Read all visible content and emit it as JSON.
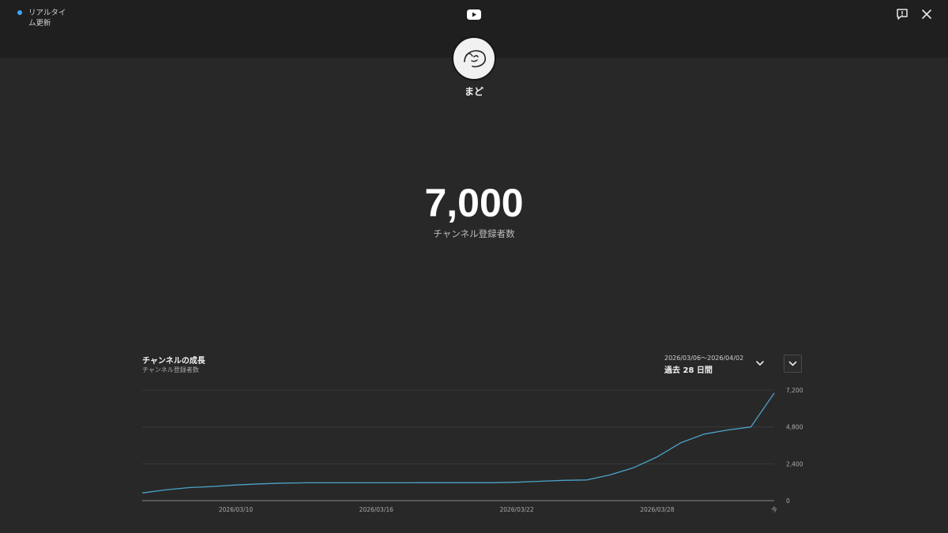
{
  "header": {
    "realtime_label": "リアルタイム更新",
    "status_color": "#3ea6ff",
    "logo_icon": "youtube-logo-icon",
    "feedback_icon": "feedback-icon",
    "close_icon": "close-icon"
  },
  "channel": {
    "name": "まど",
    "subscriber_count": "7,000",
    "subscriber_label": "チャンネル登録者数"
  },
  "growth": {
    "title": "チャンネルの成長",
    "subtitle": "チャンネル登録者数",
    "date_range": "2026/03/06〜2026/04/02",
    "period": "過去 28 日間",
    "accent_color": "#4ba3c7"
  },
  "chart_data": {
    "type": "line",
    "x": [
      "2026/03/06",
      "2026/03/07",
      "2026/03/08",
      "2026/03/09",
      "2026/03/10",
      "2026/03/11",
      "2026/03/12",
      "2026/03/13",
      "2026/03/14",
      "2026/03/15",
      "2026/03/16",
      "2026/03/17",
      "2026/03/18",
      "2026/03/19",
      "2026/03/20",
      "2026/03/21",
      "2026/03/22",
      "2026/03/23",
      "2026/03/24",
      "2026/03/25",
      "2026/03/26",
      "2026/03/27",
      "2026/03/28",
      "2026/03/29",
      "2026/03/30",
      "2026/03/31",
      "2026/04/01",
      "2026/04/02"
    ],
    "series": [
      {
        "values": [
          500,
          700,
          850,
          920,
          1020,
          1090,
          1140,
          1160,
          1160,
          1160,
          1160,
          1160,
          1170,
          1170,
          1170,
          1170,
          1200,
          1260,
          1320,
          1350,
          1680,
          2150,
          2850,
          3760,
          4330,
          4600,
          4800,
          7000
        ]
      }
    ],
    "xticks": [
      "2026/03/10",
      "2026/03/16",
      "2026/03/22",
      "2026/03/28",
      "今"
    ],
    "yticks": [
      "0",
      "2,400",
      "4,800",
      "7,200"
    ],
    "ylim": [
      0,
      7200
    ],
    "grid": true,
    "yaxis_side": "right"
  }
}
